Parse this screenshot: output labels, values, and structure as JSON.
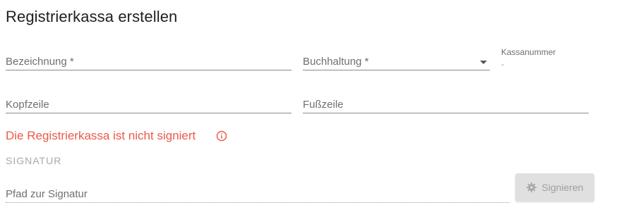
{
  "page": {
    "title": "Registrierkassa erstellen"
  },
  "form": {
    "bezeichnung": {
      "label": "Bezeichnung *"
    },
    "buchhaltung": {
      "label": "Buchhaltung *"
    },
    "kassanummer": {
      "label": "Kassanummer",
      "value": "-"
    },
    "kopfzeile": {
      "label": "Kopfzeile"
    },
    "fusszeile": {
      "label": "Fußzeile"
    }
  },
  "warning": {
    "text": "Die Registrierkassa ist nicht signiert",
    "icon": "info-icon",
    "color": "#ea5a49"
  },
  "signatur": {
    "section_label": "SIGNATUR",
    "pfad_label": "Pfad zur Signatur",
    "button_label": "Signieren",
    "button_icon": "gear-icon"
  }
}
